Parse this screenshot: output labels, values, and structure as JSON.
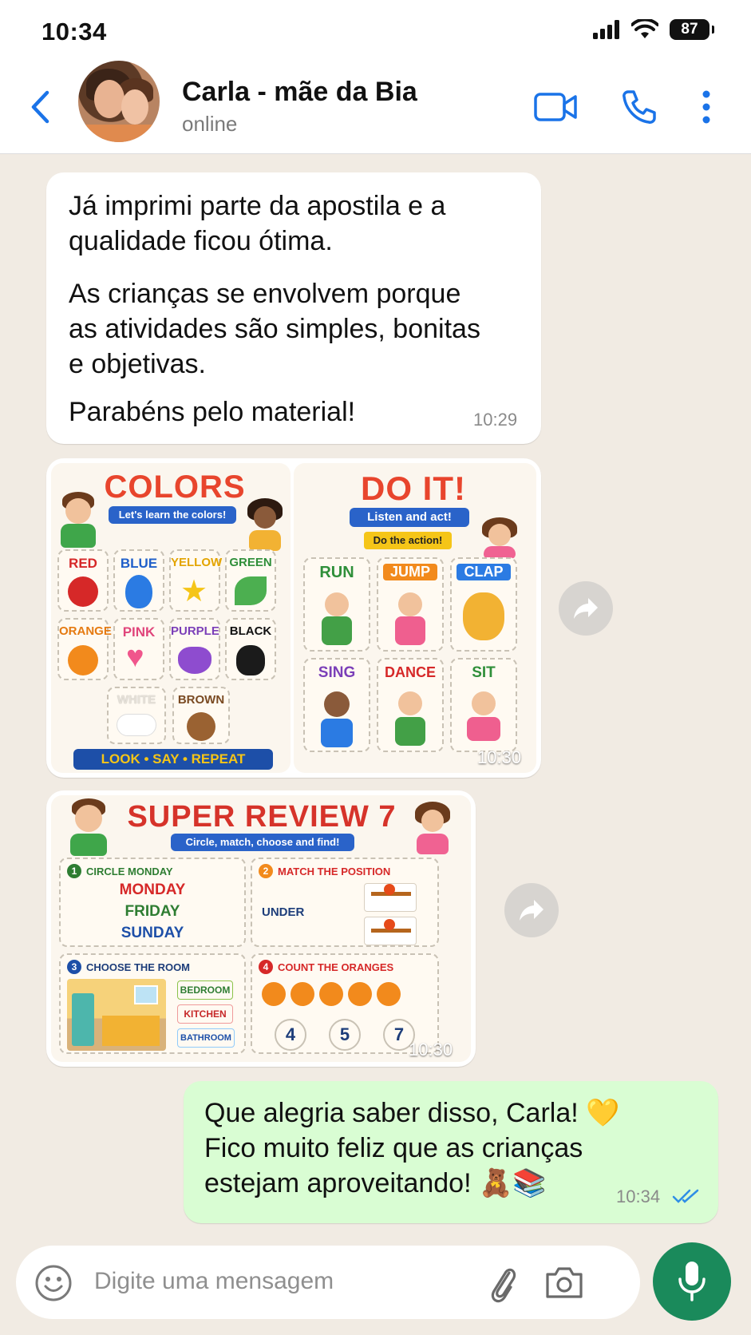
{
  "status_bar": {
    "time": "10:34",
    "battery": "87"
  },
  "header": {
    "contact_name": "Carla - mãe da Bia",
    "contact_status": "online",
    "icons": [
      "back-icon",
      "video-call-icon",
      "phone-icon",
      "more-icon"
    ]
  },
  "messages": {
    "m1": {
      "paragraphs": [
        "Já imprimi parte da apostila e a qualidade ficou ótima.",
        "As crianças se envolvem porque as atividades são simples, bonitas e objetivas.",
        "Parabéns pelo material!"
      ],
      "time": "10:29"
    },
    "m2": {
      "time": "10:30",
      "colors": {
        "title": "COLORS",
        "subtitle": "Let's learn the colors!",
        "tiles": [
          "RED",
          "BLUE",
          "YELLOW",
          "GREEN",
          "ORANGE",
          "PINK",
          "PURPLE",
          "BLACK",
          "WHITE",
          "BROWN"
        ],
        "footer": "LOOK • SAY • REPEAT"
      },
      "doit": {
        "title": "DO IT!",
        "subtitle": "Listen and act!",
        "tag": "Do the action!",
        "tiles": [
          "RUN",
          "JUMP",
          "CLAP",
          "SING",
          "DANCE",
          "SIT"
        ]
      }
    },
    "m3": {
      "time": "10:30",
      "title": "SUPER REVIEW 7",
      "subtitle": "Circle, match, choose and find!",
      "section1": {
        "num": "1",
        "label": "CIRCLE MONDAY",
        "days": [
          "MONDAY",
          "FRIDAY",
          "SUNDAY"
        ]
      },
      "section2": {
        "num": "2",
        "label": "MATCH THE POSITION",
        "word": "UNDER"
      },
      "section3": {
        "num": "3",
        "label": "CHOOSE THE ROOM",
        "rooms": [
          "BEDROOM",
          "KITCHEN",
          "BATHROOM"
        ]
      },
      "section4": {
        "num": "4",
        "label": "COUNT THE ORANGES",
        "options": [
          "4",
          "5",
          "7"
        ]
      }
    },
    "m4": {
      "lines": [
        "Que alegria saber disso, Carla! 💛",
        "Fico muito feliz que as crianças",
        "estejam aproveitando! 🧸📚"
      ],
      "time": "10:34"
    }
  },
  "input": {
    "placeholder": "Digite uma mensagem"
  },
  "colors": {
    "accent_blue": "#1a73e8",
    "mic_green": "#1a8a5b",
    "outgoing_bubble": "#d9fdd3",
    "chat_bg": "#f1ebe3"
  }
}
